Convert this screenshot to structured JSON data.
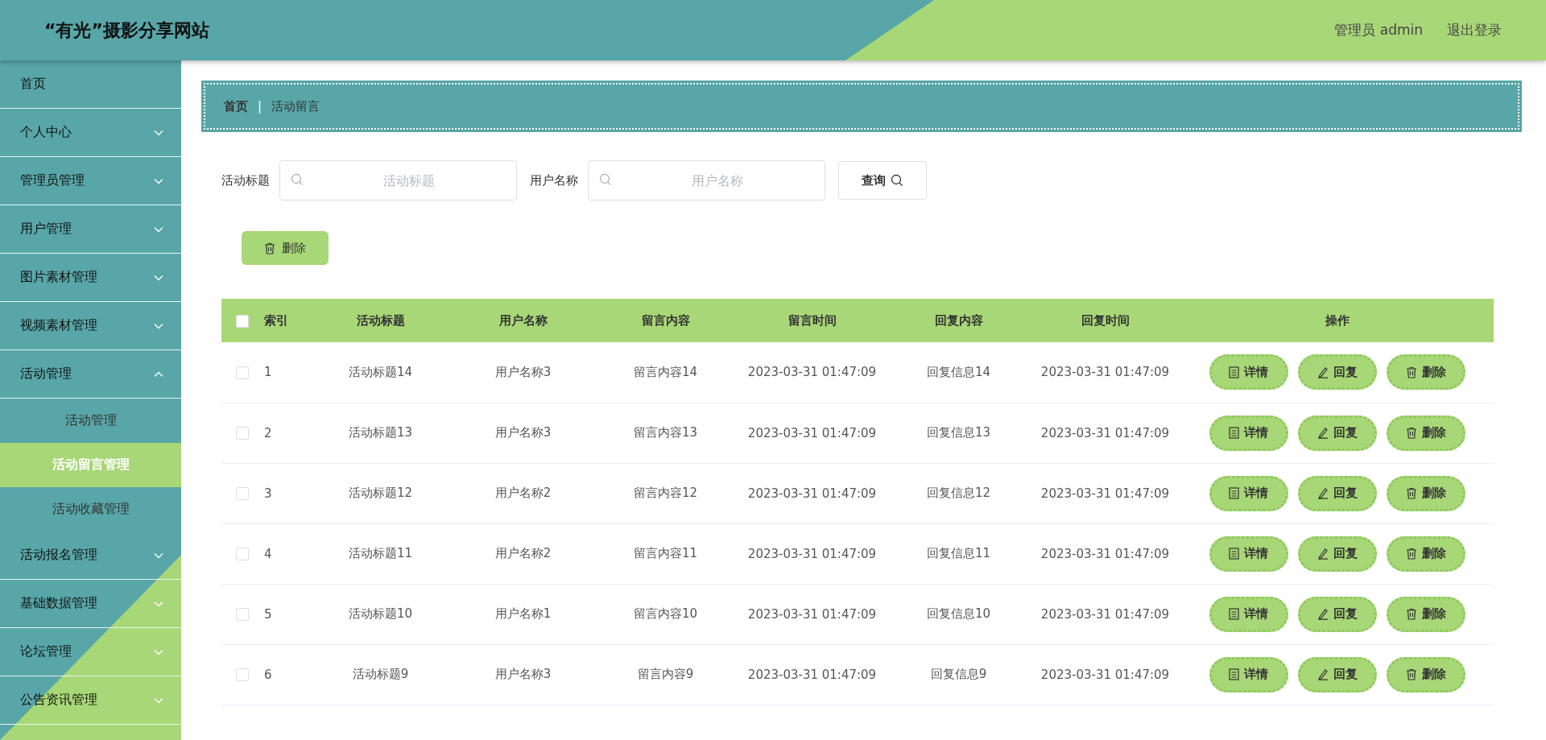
{
  "header": {
    "title": "“有光”摄影分享网站",
    "user": "管理员 admin",
    "logout": "退出登录"
  },
  "sidebar": {
    "items": [
      {
        "label": "首页",
        "selected": false
      },
      {
        "label": "个人中心",
        "expanded": false,
        "selected": false
      },
      {
        "label": "管理员管理",
        "expanded": false,
        "selected": false
      },
      {
        "label": "用户管理",
        "expanded": false,
        "selected": false
      },
      {
        "label": "图片素材管理",
        "expanded": false,
        "selected": false
      },
      {
        "label": "视频素材管理",
        "expanded": false,
        "selected": false
      },
      {
        "label": "活动管理",
        "expanded": true,
        "selected": false,
        "children": [
          {
            "label": "活动管理",
            "selected": false
          },
          {
            "label": "活动留言管理",
            "selected": true
          },
          {
            "label": "活动收藏管理",
            "selected": false
          }
        ]
      },
      {
        "label": "活动报名管理",
        "expanded": false,
        "selected": false
      },
      {
        "label": "基础数据管理",
        "expanded": false,
        "selected": false
      },
      {
        "label": "论坛管理",
        "expanded": false,
        "selected": false
      },
      {
        "label": "公告资讯管理",
        "expanded": false,
        "selected": false
      }
    ]
  },
  "breadcrumb": {
    "home": "首页",
    "separator": "|",
    "current": "活动留言"
  },
  "search": {
    "fields": [
      {
        "label": "活动标题",
        "placeholder": "活动标题"
      },
      {
        "label": "用户名称",
        "placeholder": "用户名称"
      }
    ],
    "button": "查询"
  },
  "delete_button": "删除",
  "table": {
    "all_checked": false,
    "columns": [
      "索引",
      "活动标题",
      "用户名称",
      "留言内容",
      "留言时间",
      "回复内容",
      "回复时间",
      "操作"
    ],
    "rows": [
      {
        "checked": false,
        "cells": [
          "1",
          "活动标题14",
          "用户名称3",
          "留言内容14",
          "2023-03-31 01:47:09",
          "回复信息14",
          "2023-03-31 01:47:09"
        ],
        "actions": [
          "详情",
          "回复",
          "删除"
        ]
      },
      {
        "checked": false,
        "cells": [
          "2",
          "活动标题13",
          "用户名称3",
          "留言内容13",
          "2023-03-31 01:47:09",
          "回复信息13",
          "2023-03-31 01:47:09"
        ],
        "actions": [
          "详情",
          "回复",
          "删除"
        ]
      },
      {
        "checked": false,
        "cells": [
          "3",
          "活动标题12",
          "用户名称2",
          "留言内容12",
          "2023-03-31 01:47:09",
          "回复信息12",
          "2023-03-31 01:47:09"
        ],
        "actions": [
          "详情",
          "回复",
          "删除"
        ]
      },
      {
        "checked": false,
        "cells": [
          "4",
          "活动标题11",
          "用户名称2",
          "留言内容11",
          "2023-03-31 01:47:09",
          "回复信息11",
          "2023-03-31 01:47:09"
        ],
        "actions": [
          "详情",
          "回复",
          "删除"
        ]
      },
      {
        "checked": false,
        "cells": [
          "5",
          "活动标题10",
          "用户名称1",
          "留言内容10",
          "2023-03-31 01:47:09",
          "回复信息10",
          "2023-03-31 01:47:09"
        ],
        "actions": [
          "详情",
          "回复",
          "删除"
        ]
      },
      {
        "checked": false,
        "cells": [
          "6",
          "活动标题9",
          "用户名称3",
          "留言内容9",
          "2023-03-31 01:47:09",
          "回复信息9",
          "2023-03-31 01:47:09"
        ],
        "actions": [
          "详情",
          "回复",
          "删除"
        ]
      }
    ]
  }
}
